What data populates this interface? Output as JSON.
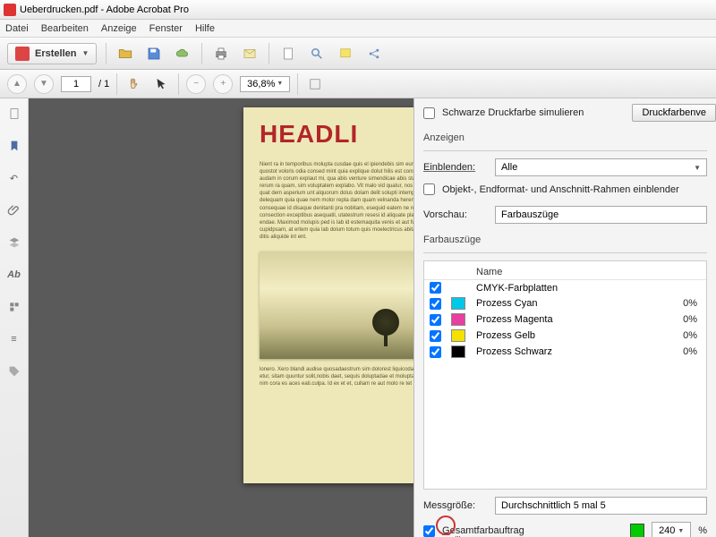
{
  "title": "Ueberdrucken.pdf - Adobe Acrobat Pro",
  "menu": [
    "Datei",
    "Bearbeiten",
    "Anzeige",
    "Fenster",
    "Hilfe"
  ],
  "create_label": "Erstellen",
  "nav": {
    "page": "1",
    "total": "1",
    "zoom": "36,8%"
  },
  "doc": {
    "headline": "HEADLI",
    "body": "Nient ra in temporibus molupta cusdae quis el ipiendebis sim eum est volupid maximi, optasus alitis quostot voloris odia consed mint quia explique dolut hilis est conseque oribus voloristis quam audam in corum explaut mi, qua abis venture simendicae abis startem cas cumresteri, mosantia sin rerum ra quam, sim voluptatem explabo. Vit malo vid quatur, nos dolupto. At hit es ea de net vid quat dem asperium unt alquorum dolus dolam delit solupti intempor quos con et alte quias delequam quia quae nem molor repta dam quam velnanda herena que et am dig ra sam cum consequae id disaque denitanti pra nobitam, esequid eatem ne repre id voloristas sitques qui consection exceptibus asequatil, utatestrum resesi id aliquate plan cus aliqua es mudam fugit endae. Maximod molupis ped is lab id estemaquita venis et aut fuga. Et venis illas quodit et cupidpsam, at ertem quia lab dolum totum quis moelectricus abitatur aut vent moluptibusti relius ditis aliquide int ent.",
    "caption": "lonero. Xero blandi audise quosadaestrum sim dolorest liquicodas quae mint et molupta que rem etur, sitam quuntur solit,nobis daet, sequis doluptadae et moluptat am. Ducis vertatur quis nullia nim cora es aces eati.culpa. Id ex et et, cullam re aut molo re tet aut dolrei catqunt."
  },
  "panel": {
    "simulate_black": "Schwarze Druckfarbe simulieren",
    "btn_inkcov": "Druckfarbenve",
    "anzeigen": "Anzeigen",
    "einblenden": "Einblenden:",
    "einblenden_value": "Alle",
    "frames": "Objekt-, Endformat- und Anschnitt-Rahmen einblender",
    "vorschau": "Vorschau:",
    "vorschau_value": "Farbauszüge",
    "farbauszuge": "Farbauszüge",
    "col_name": "Name",
    "rows": [
      {
        "name": "CMYK-Farbplatten",
        "swatch": "",
        "pct": ""
      },
      {
        "name": "Prozess Cyan",
        "swatch": "#00c8e8",
        "pct": "0%"
      },
      {
        "name": "Prozess Magenta",
        "swatch": "#e83fa0",
        "pct": "0%"
      },
      {
        "name": "Prozess Gelb",
        "swatch": "#f5e100",
        "pct": "0%"
      },
      {
        "name": "Prozess Schwarz",
        "swatch": "#000000",
        "pct": "0%"
      }
    ],
    "messgroesse": "Messgröße:",
    "messgroesse_value": "Durchschnittlich 5 mal 5",
    "gesamt": "Gesamtfarbauftrag",
    "gesamt_value": "240",
    "pct_sym": "%"
  }
}
